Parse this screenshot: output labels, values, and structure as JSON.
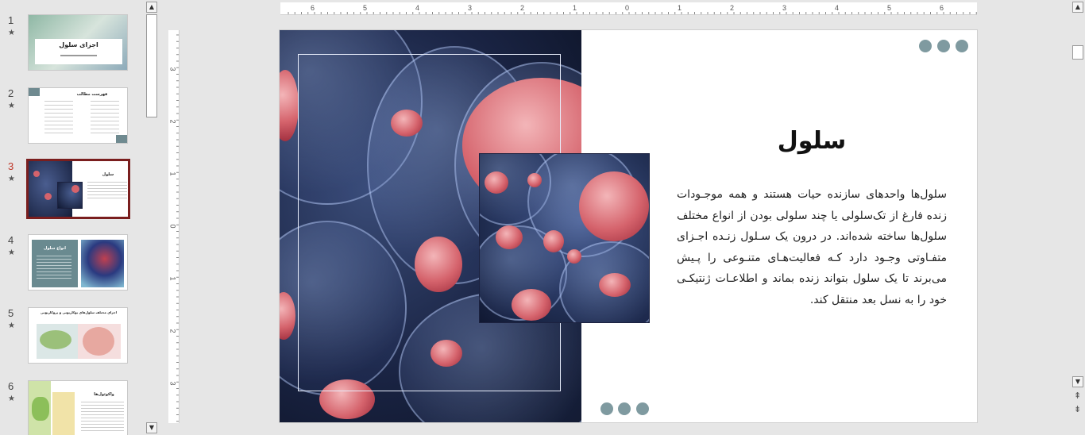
{
  "thumbnails": [
    {
      "number": "1",
      "title": "اجزای سلول",
      "star": "★"
    },
    {
      "number": "2",
      "title": "فهرست مطالب",
      "star": "★"
    },
    {
      "number": "3",
      "title": "سلول",
      "star": "★"
    },
    {
      "number": "4",
      "title": "انواع سلول",
      "star": "★"
    },
    {
      "number": "5",
      "title": "اجزای مختلف سلول‌های یوکاریوتی و پروکاریوتی",
      "star": "★"
    },
    {
      "number": "6",
      "title": "واکوئول‌ها",
      "star": "★"
    }
  ],
  "ruler": {
    "horizontal": [
      "6",
      "5",
      "4",
      "3",
      "2",
      "1",
      "0",
      "1",
      "2",
      "3",
      "4",
      "5",
      "6"
    ],
    "vertical": [
      "3",
      "2",
      "1",
      "0",
      "1",
      "2",
      "3"
    ]
  },
  "slide": {
    "title": "سلول",
    "body": "سلول‌ها واحدهای سازنده حیات هستند و همه موجـودات زنده فارغ از تک‌سلولی یا چند سلولی بودن از انواع مختلف سلول‌ها ساخته شده‌اند. در درون یک سـلول زنـده اجـزای متفـاوتی وجـود دارد کـه فعالیت‌هـای متنـوعی را پـیش می‌برند تا یک سلول بتواند زنده بماند و اطلاعـات ژنتیکـی خود را به نسل بعد منتقل کند."
  },
  "scroll": {
    "up_arrow": "▲",
    "down_arrow": "▼",
    "prev_slide": "⇞",
    "next_slide": "⇟"
  },
  "colors": {
    "selected_border": "#7a1e1e",
    "accent_dots": "#7f9aa0",
    "active_number": "#c0392b"
  }
}
